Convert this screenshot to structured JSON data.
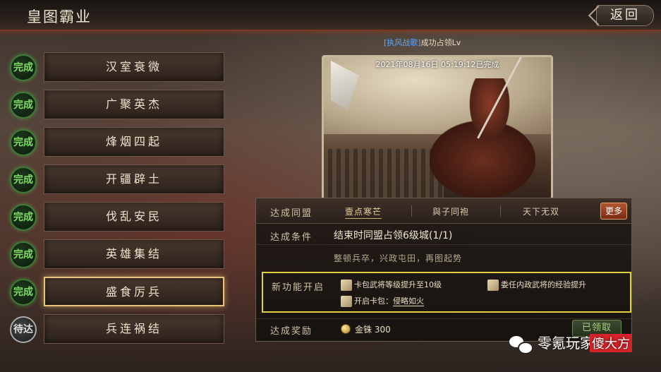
{
  "header": {
    "title": "皇图霸业",
    "back_label": "返回"
  },
  "stages": [
    {
      "label": "汉室衰微",
      "badge": "完成",
      "done": true,
      "active": false
    },
    {
      "label": "广聚英杰",
      "badge": "完成",
      "done": true,
      "active": false
    },
    {
      "label": "烽烟四起",
      "badge": "完成",
      "done": true,
      "active": false
    },
    {
      "label": "开疆辟土",
      "badge": "完成",
      "done": true,
      "active": false
    },
    {
      "label": "伐乱安民",
      "badge": "完成",
      "done": true,
      "active": false
    },
    {
      "label": "英雄集结",
      "badge": "完成",
      "done": true,
      "active": false
    },
    {
      "label": "盛食厉兵",
      "badge": "完成",
      "done": true,
      "active": true
    },
    {
      "label": "兵连祸结",
      "badge": "待达",
      "done": false,
      "active": false
    }
  ],
  "news": {
    "tag": "[执风战歌]",
    "text": "成功占领Lv"
  },
  "painting": {
    "timestamp": "2021年08月16日 05:19:12已完成"
  },
  "panel": {
    "alliance_label": "达成同盟",
    "alliances": [
      "壹点寒芒",
      "與子同袍",
      "天下无双"
    ],
    "more_label": "更多",
    "condition_label": "达成条件",
    "condition_value": "结束时同盟占领6级城(1/1)",
    "condition_desc": "整顿兵卒，兴政屯田，再图起势",
    "feature_label": "新功能开启",
    "features": {
      "f1": "卡包武将等级提升至10级",
      "f2": "委任内政武将的经验提升",
      "f3_prefix": "开启卡包：",
      "f3_link": "侵略如火"
    },
    "reward_label": "达成奖励",
    "reward_value": "金铢 300",
    "claimed_label": "已领取"
  },
  "watermark": {
    "text": "零氪玩家",
    "stamp": "傻大方"
  },
  "colors": {
    "accent": "#e8c47a",
    "done_green": "#7fdc62",
    "highlight_box": "#e0d040",
    "more_red": "#b2542e"
  }
}
